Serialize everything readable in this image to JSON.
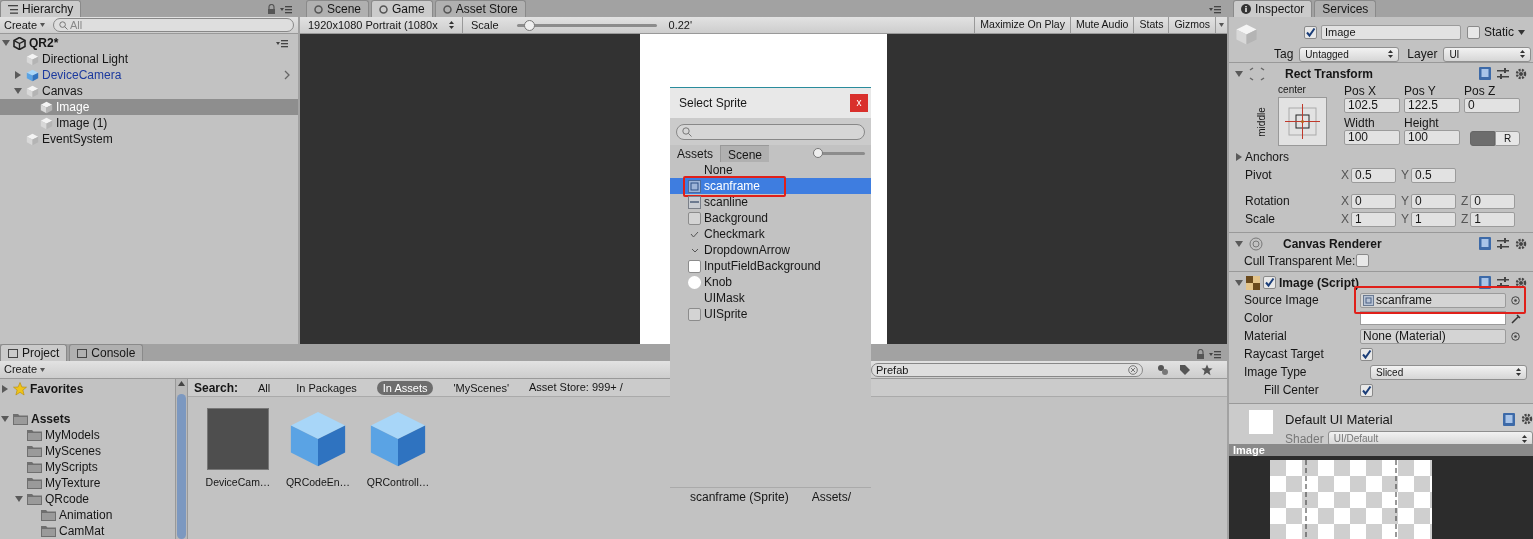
{
  "hierarchy": {
    "tab": "Hierarchy",
    "create": "Create",
    "search_placeholder": "All",
    "scene": {
      "label": "QR2*",
      "expanded": true
    },
    "items": [
      {
        "label": "Directional Light",
        "prefab": false,
        "selected": false
      },
      {
        "label": "DeviceCamera",
        "prefab": true,
        "selected": false,
        "expanded": false
      },
      {
        "label": "Canvas",
        "prefab": false,
        "selected": false,
        "expanded": true,
        "children": [
          {
            "label": "Image",
            "prefab": false,
            "selected": true
          },
          {
            "label": "Image (1)",
            "prefab": false,
            "selected": false
          }
        ]
      },
      {
        "label": "EventSystem",
        "prefab": false,
        "selected": false
      }
    ]
  },
  "game": {
    "tabs": [
      {
        "label": "Scene",
        "selected": false
      },
      {
        "label": "Game",
        "selected": true
      },
      {
        "label": "Asset Store",
        "selected": false
      }
    ],
    "resolution": "1920x1080 Portrait (1080x",
    "scale_label": "Scale",
    "scale": {
      "level": 0.06,
      "reading": "0.22'"
    },
    "buttons": [
      "Maximize On Play",
      "Mute Audio",
      "Stats",
      "Gizmos"
    ]
  },
  "select_sprite": {
    "title": "Select Sprite",
    "close": "x",
    "tabs": [
      {
        "label": "Assets",
        "selected": true
      },
      {
        "label": "Scene",
        "selected": false
      }
    ],
    "size": {
      "level": 0
    },
    "items": [
      {
        "label": "None",
        "kind": "none",
        "selected": false,
        "highlighted": false
      },
      {
        "label": "scanframe",
        "kind": "frame",
        "selected": true,
        "highlighted": true
      },
      {
        "label": "scanline",
        "kind": "line",
        "selected": false,
        "highlighted": false
      },
      {
        "label": "Background",
        "kind": "box",
        "selected": false,
        "highlighted": false
      },
      {
        "label": "Checkmark",
        "kind": "check",
        "selected": false,
        "highlighted": false
      },
      {
        "label": "DropdownArrow",
        "kind": "arrow",
        "selected": false,
        "highlighted": false
      },
      {
        "label": "InputFieldBackground",
        "kind": "white",
        "selected": false,
        "highlighted": false
      },
      {
        "label": "Knob",
        "kind": "knob",
        "selected": false,
        "highlighted": false
      },
      {
        "label": "UIMask",
        "kind": "none",
        "selected": false,
        "highlighted": false
      },
      {
        "label": "UISprite",
        "kind": "box",
        "selected": false,
        "highlighted": false
      }
    ],
    "footer": {
      "name": "scanframe (Sprite)",
      "path": "Assets/"
    }
  },
  "inspector": {
    "tabs": [
      {
        "label": "Inspector",
        "selected": true
      },
      {
        "label": "Services",
        "selected": false
      }
    ],
    "active": true,
    "name": "Image",
    "static": {
      "label": "Static",
      "checked": false
    },
    "tag_label": "Tag",
    "tag": "Untagged",
    "layer_label": "Layer",
    "layer": "UI",
    "rect_transform": {
      "title": "Rect Transform",
      "expanded": true,
      "anchor_h": "center",
      "anchor_v": "middle",
      "fields": [
        {
          "label": "Pos X",
          "value": "102.5"
        },
        {
          "label": "Pos Y",
          "value": "122.5"
        },
        {
          "label": "Pos Z",
          "value": "0"
        },
        {
          "label": "Width",
          "value": "100"
        },
        {
          "label": "Height",
          "value": "100"
        }
      ],
      "blueprint": true,
      "raw_button": "R",
      "anchors": {
        "label": "Anchors",
        "expanded": false
      },
      "rows": [
        {
          "label": "Pivot",
          "axes": [
            {
              "axis": "X",
              "value": "0.5"
            },
            {
              "axis": "Y",
              "value": "0.5"
            }
          ]
        },
        {
          "label": "Rotation",
          "axes": [
            {
              "axis": "X",
              "value": "0"
            },
            {
              "axis": "Y",
              "value": "0"
            },
            {
              "axis": "Z",
              "value": "0"
            }
          ]
        },
        {
          "label": "Scale",
          "axes": [
            {
              "axis": "X",
              "value": "1"
            },
            {
              "axis": "Y",
              "value": "1"
            },
            {
              "axis": "Z",
              "value": "1"
            }
          ]
        }
      ]
    },
    "canvas_renderer": {
      "title": "Canvas Renderer",
      "expanded": true,
      "cull_label": "Cull Transparent Me:",
      "cull": false
    },
    "image": {
      "title": "Image (Script)",
      "expanded": true,
      "enabled": true,
      "fields": [
        {
          "label": "Source Image",
          "kind": "object",
          "value": "scanframe",
          "icon": true,
          "highlighted": true
        },
        {
          "label": "Color",
          "kind": "color",
          "color": "#ffffff"
        },
        {
          "label": "Material",
          "kind": "object",
          "value": "None (Material)",
          "icon": false
        },
        {
          "label": "Raycast Target",
          "kind": "check",
          "checked": true
        },
        {
          "label": "Image Type",
          "kind": "select",
          "value": "Sliced",
          "children": [
            {
              "label": "Fill Center",
              "kind": "check",
              "checked": true
            }
          ]
        }
      ]
    },
    "material": {
      "name": "Default UI Material",
      "shader_label": "Shader",
      "shader": "UI/Default"
    },
    "preview": {
      "label": "Image"
    }
  },
  "project": {
    "tabs": [
      {
        "label": "Project",
        "selected": true
      },
      {
        "label": "Console",
        "selected": false
      }
    ],
    "create": "Create",
    "search_value": "Prefab",
    "tree": [
      {
        "label": "Favorites",
        "kind": "favorites",
        "expanded": false
      },
      {
        "label": "Assets",
        "kind": "folder",
        "expanded": true,
        "children": [
          {
            "label": "MyModels",
            "kind": "folder"
          },
          {
            "label": "MyScenes",
            "kind": "folder"
          },
          {
            "label": "MyScripts",
            "kind": "folder"
          },
          {
            "label": "MyTexture",
            "kind": "folder"
          },
          {
            "label": "QRcode",
            "kind": "folder",
            "expanded": true,
            "children": [
              {
                "label": "Animation",
                "kind": "folder"
              },
              {
                "label": "CamMat",
                "kind": "folder"
              }
            ]
          }
        ]
      }
    ],
    "search_label": "Search:",
    "filters": [
      {
        "label": "All",
        "selected": false
      },
      {
        "label": "In Packages",
        "selected": false
      },
      {
        "label": "In Assets",
        "selected": true
      },
      {
        "label": "'MyScenes'",
        "selected": false
      }
    ],
    "asset_store": "Asset Store: 999+ /",
    "assets": [
      {
        "label": "DeviceCam…",
        "kind": "texture"
      },
      {
        "label": "QRCodeEn…",
        "kind": "prefab"
      },
      {
        "label": "QRControll…",
        "kind": "prefab"
      }
    ]
  }
}
